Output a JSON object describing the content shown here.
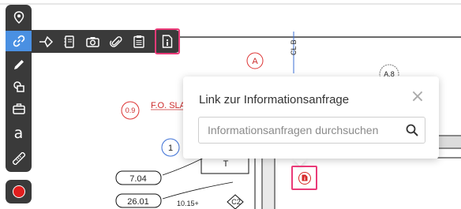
{
  "drawing": {
    "grid_label_a": "A",
    "grid_label_a8": "A.8",
    "grid_label_0_9": "0.9",
    "grid_label_1": "1",
    "center_line": "CL B",
    "slab_note": "F.O. SLA",
    "room_tag": "T",
    "elevation_1": "7.04",
    "elevation_2": "26.01",
    "dimension_note": "10.15+",
    "column_tag": "C2"
  },
  "toolbar": {
    "tools": [
      {
        "name": "location",
        "icon": "map-pin-icon"
      },
      {
        "name": "link",
        "icon": "link-icon",
        "active": true
      },
      {
        "name": "pen",
        "icon": "pencil-icon"
      },
      {
        "name": "shapes",
        "icon": "shapes-icon"
      },
      {
        "name": "toolbox",
        "icon": "briefcase-icon"
      },
      {
        "name": "text",
        "icon": "text-icon",
        "label": "a"
      },
      {
        "name": "measure",
        "icon": "ruler-icon"
      }
    ],
    "record_icon": "record-icon"
  },
  "link_submenu": {
    "items": [
      {
        "name": "link-to-sheet",
        "icon": "arrow-diamond-icon"
      },
      {
        "name": "link-to-document",
        "icon": "document-icon"
      },
      {
        "name": "link-to-photo",
        "icon": "camera-icon"
      },
      {
        "name": "link-to-attachment",
        "icon": "paperclip-icon"
      },
      {
        "name": "link-to-task",
        "icon": "clipboard-icon"
      },
      {
        "name": "link-to-rfi",
        "icon": "rfi-document-icon",
        "highlighted": true
      }
    ]
  },
  "popover": {
    "title": "Link zur Informationsanfrage",
    "close_icon": "close-icon",
    "search": {
      "placeholder": "Informationsanfragen durchsuchen",
      "value": "",
      "icon": "search-icon"
    }
  },
  "colors": {
    "toolbar_bg": "#3a3a3a",
    "active_tool": "#4a90e2",
    "highlight": "#ea3a78",
    "marker_red": "#d62828",
    "record_red": "#e01e1e"
  }
}
